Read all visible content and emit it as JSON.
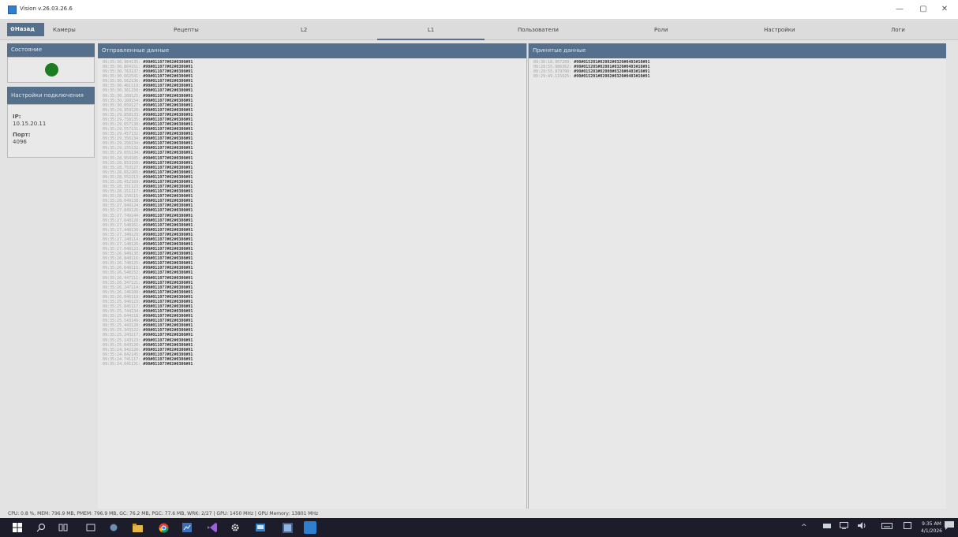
{
  "window": {
    "title": "Vision v.26.03.26.6",
    "min_glyph": "—",
    "max_glyph": "▢",
    "close_glyph": "✕"
  },
  "nav": {
    "back_label": "✿Назад",
    "tabs": [
      {
        "label": "Камеры"
      },
      {
        "label": "Рецепты"
      },
      {
        "label": "L2"
      },
      {
        "label": "L1",
        "active": true
      },
      {
        "label": "Пользователи"
      },
      {
        "label": "Роли"
      },
      {
        "label": "Настройки"
      },
      {
        "label": "Логи"
      }
    ]
  },
  "status_panel": {
    "title": "Состояние",
    "indicator_color": "#1c7c23"
  },
  "connection": {
    "title": "Настройки подключения",
    "ip_label": "IP:",
    "ip_value": "10.15.20.11",
    "port_label": "Порт:",
    "port_value": "4096"
  },
  "sent": {
    "title": "Отправленные данные",
    "lines": [
      {
        "ts": "09:35:30.964135",
        "msg": "#90#011077#02#0300#91"
      },
      {
        "ts": "09:35:30.864151",
        "msg": "#90#011077#02#0300#91"
      },
      {
        "ts": "09:35:30.763137",
        "msg": "#90#011077#02#0300#91"
      },
      {
        "ts": "09:35:30.662541",
        "msg": "#90#011077#02#0300#91"
      },
      {
        "ts": "09:35:30.562136",
        "msg": "#90#011077#02#0300#91"
      },
      {
        "ts": "09:35:30.461119",
        "msg": "#90#011077#02#0300#91"
      },
      {
        "ts": "09:35:30.361150",
        "msg": "#90#011077#02#0300#91"
      },
      {
        "ts": "09:35:30.260125",
        "msg": "#90#011077#02#0300#91"
      },
      {
        "ts": "09:35:30.160154",
        "msg": "#90#011077#02#0300#91"
      },
      {
        "ts": "09:35:30.059127",
        "msg": "#90#011077#02#0300#91"
      },
      {
        "ts": "09:35:29.959120",
        "msg": "#90#011077#02#0300#91"
      },
      {
        "ts": "09:35:29.858133",
        "msg": "#90#011077#02#0300#91"
      },
      {
        "ts": "09:35:29.758135",
        "msg": "#90#011077#02#0300#91"
      },
      {
        "ts": "09:35:29.657138",
        "msg": "#90#011077#02#0300#91"
      },
      {
        "ts": "09:35:29.557131",
        "msg": "#90#011077#02#0300#91"
      },
      {
        "ts": "09:35:29.457132",
        "msg": "#90#011077#02#0300#91"
      },
      {
        "ts": "09:35:29.356134",
        "msg": "#90#011077#02#0300#91"
      },
      {
        "ts": "09:35:29.256134",
        "msg": "#90#011077#02#0300#91"
      },
      {
        "ts": "09:35:29.155132",
        "msg": "#90#011077#02#0300#91"
      },
      {
        "ts": "09:35:29.055134",
        "msg": "#90#011077#02#0300#91"
      },
      {
        "ts": "09:35:28.954185",
        "msg": "#90#011077#02#0300#91"
      },
      {
        "ts": "09:35:28.853150",
        "msg": "#90#011077#02#0300#91"
      },
      {
        "ts": "09:35:28.753127",
        "msg": "#90#011077#02#0300#91"
      },
      {
        "ts": "09:35:28.652265",
        "msg": "#90#011077#02#0300#91"
      },
      {
        "ts": "09:35:28.552213",
        "msg": "#90#011077#02#0300#91"
      },
      {
        "ts": "09:35:28.452169",
        "msg": "#90#011077#02#0300#91"
      },
      {
        "ts": "09:35:28.351123",
        "msg": "#90#011077#02#0300#91"
      },
      {
        "ts": "09:35:28.251117",
        "msg": "#90#011077#02#0300#91"
      },
      {
        "ts": "09:35:28.150115",
        "msg": "#90#011077#02#0300#91"
      },
      {
        "ts": "09:35:28.049138",
        "msg": "#90#011077#02#0300#91"
      },
      {
        "ts": "09:35:27.949124",
        "msg": "#90#011077#02#0300#91"
      },
      {
        "ts": "09:35:27.849126",
        "msg": "#90#011077#02#0300#91"
      },
      {
        "ts": "09:35:27.749144",
        "msg": "#90#011077#02#0300#91"
      },
      {
        "ts": "09:35:27.648120",
        "msg": "#90#011077#02#0300#91"
      },
      {
        "ts": "09:35:27.548161",
        "msg": "#90#011077#02#0300#91"
      },
      {
        "ts": "09:35:27.448130",
        "msg": "#90#011077#02#0300#91"
      },
      {
        "ts": "09:35:27.348129",
        "msg": "#90#011077#02#0300#91"
      },
      {
        "ts": "09:35:27.248114",
        "msg": "#90#011077#02#0300#91"
      },
      {
        "ts": "09:35:27.148126",
        "msg": "#90#011077#02#0300#91"
      },
      {
        "ts": "09:35:27.048123",
        "msg": "#90#011077#02#0300#91"
      },
      {
        "ts": "09:35:26.948130",
        "msg": "#90#011077#02#0300#91"
      },
      {
        "ts": "09:35:26.848116",
        "msg": "#90#011077#02#0300#91"
      },
      {
        "ts": "09:35:26.748125",
        "msg": "#90#011077#02#0300#91"
      },
      {
        "ts": "09:35:26.648115",
        "msg": "#90#011077#02#0300#91"
      },
      {
        "ts": "09:35:26.548152",
        "msg": "#90#011077#02#0300#91"
      },
      {
        "ts": "09:35:26.447111",
        "msg": "#90#011077#02#0300#91"
      },
      {
        "ts": "09:35:26.347121",
        "msg": "#90#011077#02#0300#91"
      },
      {
        "ts": "09:35:26.247114",
        "msg": "#90#011077#02#0300#91"
      },
      {
        "ts": "09:35:26.146100",
        "msg": "#90#011077#02#0300#91"
      },
      {
        "ts": "09:35:26.046119",
        "msg": "#90#011077#02#0300#91"
      },
      {
        "ts": "09:35:25.946123",
        "msg": "#90#011077#02#0300#91"
      },
      {
        "ts": "09:35:25.845117",
        "msg": "#90#011077#02#0300#91"
      },
      {
        "ts": "09:35:25.744134",
        "msg": "#90#011077#02#0300#91"
      },
      {
        "ts": "09:35:25.644118",
        "msg": "#90#011077#02#0300#91"
      },
      {
        "ts": "09:35:25.543149",
        "msg": "#90#011077#02#0300#91"
      },
      {
        "ts": "09:35:25.443120",
        "msg": "#90#011077#02#0300#91"
      },
      {
        "ts": "09:35:25.343122",
        "msg": "#90#011077#02#0300#91"
      },
      {
        "ts": "09:35:25.243117",
        "msg": "#90#011077#02#0300#91"
      },
      {
        "ts": "09:35:25.143123",
        "msg": "#90#011077#02#0300#91"
      },
      {
        "ts": "09:35:25.043120",
        "msg": "#90#011077#02#0300#91"
      },
      {
        "ts": "09:35:24.942120",
        "msg": "#90#011077#02#0300#91"
      },
      {
        "ts": "09:35:24.842145",
        "msg": "#90#011077#02#0300#91"
      },
      {
        "ts": "09:35:24.741117",
        "msg": "#90#011077#02#0300#91"
      },
      {
        "ts": "09:35:24.641131",
        "msg": "#90#011077#02#0300#91"
      }
    ]
  },
  "received": {
    "title": "Принятые данные",
    "lines": [
      {
        "ts": "09:30:18.967209",
        "msg": "#90#015201#02002#0320#0403#10#91"
      },
      {
        "ts": "09:29:55.986362",
        "msg": "#90#015205#02001#0320#0403#10#91"
      },
      {
        "ts": "09:29:55.979700",
        "msg": "#90#015203#02000#0320#0403#10#91"
      },
      {
        "ts": "09:29:49.115925",
        "msg": "#90#015201#02002#0320#0403#10#91"
      }
    ]
  },
  "statusbar": {
    "text": "CPU: 0.8 %, MEM: 796.9 MB, PMEM: 796.9 MB, GC: 76.2 MB, PGC: 77.6 MB, WRK: 2/27 | GPU: 1450 MHz | GPU Memory: 13801 MHz"
  },
  "taskbar": {
    "icons": [
      "windows-icon",
      "search-icon",
      "task-view-icon",
      "app-icon",
      "app-icon",
      "file-explorer-icon",
      "chrome-icon",
      "app-icon",
      "visual-studio-icon",
      "gear-icon",
      "app-icon",
      "app-icon",
      "vision-app-icon"
    ],
    "tray": {
      "chevron": "^",
      "time": "9:35 AM",
      "date": "4/1/2026"
    }
  }
}
